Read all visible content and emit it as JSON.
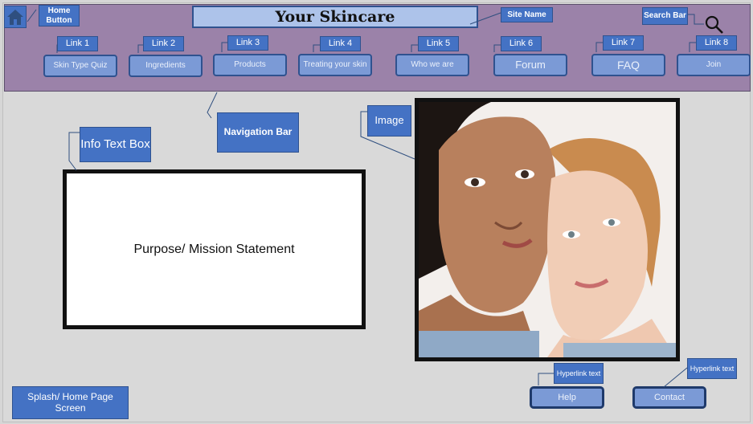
{
  "labels": {
    "home_button": "Home Button",
    "site_name": "Site Name",
    "search_bar": "Search Bar",
    "navigation_bar": "Navigation Bar",
    "info_text_box": "Info Text Box",
    "image": "Image",
    "hyperlink_text_1": "Hyperlink text",
    "hyperlink_text_2": "Hyperlink text",
    "screen_name": "Splash/ Home Page Screen"
  },
  "header": {
    "title": "Your Skincare"
  },
  "nav": {
    "links": [
      {
        "tag": "Link 1",
        "label": "Skin Type Quiz"
      },
      {
        "tag": "Link 2",
        "label": "Ingredients"
      },
      {
        "tag": "Link 3",
        "label": "Products"
      },
      {
        "tag": "Link 4",
        "label": "Treating your skin"
      },
      {
        "tag": "Link 5",
        "label": "Who we are"
      },
      {
        "tag": "Link 6",
        "label": "Forum"
      },
      {
        "tag": "Link 7",
        "label": "FAQ"
      },
      {
        "tag": "Link 8",
        "label": "Join"
      }
    ]
  },
  "main": {
    "mission_text": "Purpose/ Mission Statement"
  },
  "footer": {
    "help_label": "Help",
    "contact_label": "Contact"
  },
  "icons": {
    "home": "home-icon",
    "search": "search-icon",
    "photo": "two-faces-photo"
  },
  "colors": {
    "nav_bg": "#9b82a9",
    "tag_blue": "#4472c4",
    "button_blue": "#7b9ad6",
    "title_bg": "#adc3ea"
  }
}
